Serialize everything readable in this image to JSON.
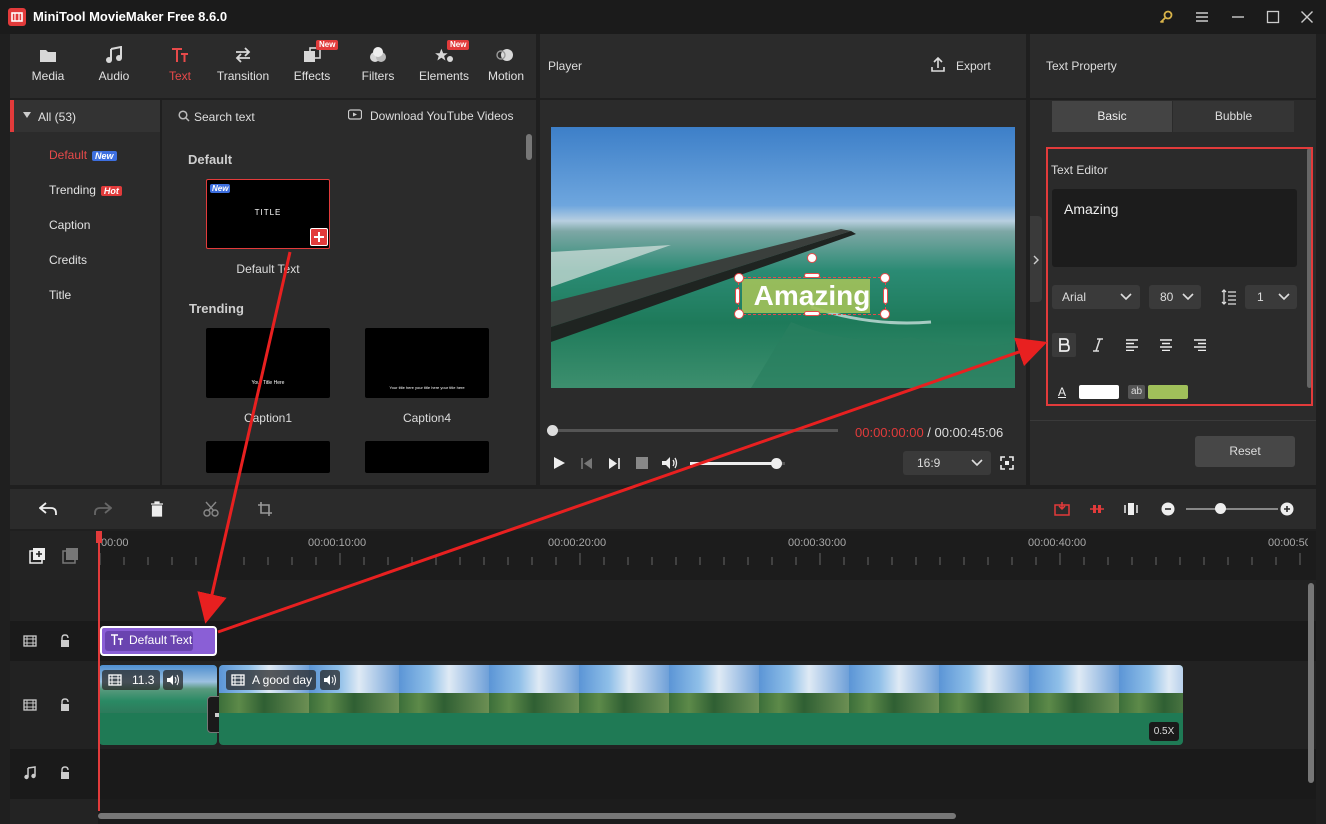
{
  "app": {
    "title": "MiniTool MovieMaker Free 8.6.0"
  },
  "toolbar": {
    "tabs": [
      {
        "label": "Media",
        "icon": "media-icon"
      },
      {
        "label": "Audio",
        "icon": "audio-icon"
      },
      {
        "label": "Text",
        "icon": "text-icon",
        "active": true
      },
      {
        "label": "Transition",
        "icon": "transition-icon"
      },
      {
        "label": "Effects",
        "icon": "effects-icon",
        "badge": "New"
      },
      {
        "label": "Filters",
        "icon": "filters-icon"
      },
      {
        "label": "Elements",
        "icon": "elements-icon",
        "badge": "New"
      },
      {
        "label": "Motion",
        "icon": "motion-icon"
      }
    ]
  },
  "categories": {
    "all_label": "All (53)",
    "items": [
      {
        "label": "Default",
        "badge": "New",
        "active": true
      },
      {
        "label": "Trending",
        "badge": "Hot"
      },
      {
        "label": "Caption"
      },
      {
        "label": "Credits"
      },
      {
        "label": "Title"
      }
    ]
  },
  "library": {
    "search_placeholder": "Search text",
    "download_label": "Download YouTube Videos",
    "sections": [
      {
        "title": "Default",
        "items": [
          {
            "label": "Default Text",
            "thumb_text": "TITLE",
            "badge": "New"
          }
        ]
      },
      {
        "title": "Trending",
        "items": [
          {
            "label": "Caption1",
            "thumb_text": "Your Title Here"
          },
          {
            "label": "Caption4",
            "thumb_text": "Your title here your title here your title here"
          }
        ]
      }
    ]
  },
  "player": {
    "label": "Player",
    "export_label": "Export",
    "overlay_text": "Amazing",
    "current_time": "00:00:00:00",
    "separator": " / ",
    "total_time": "00:00:45:06",
    "aspect": "16:9",
    "volume": 0.9
  },
  "text_property": {
    "title": "Text Property",
    "tabs": [
      "Basic",
      "Bubble"
    ],
    "editor_label": "Text Editor",
    "editor_value": "Amazing",
    "font": "Arial",
    "size": "80",
    "line_spacing": "1",
    "font_color": "#ffffff",
    "bg_color": "#a0c05a",
    "bg_label": "ab",
    "font_color_label": "A",
    "reset_label": "Reset"
  },
  "timeline": {
    "ruler": [
      "00:00",
      "00:00:10:00",
      "00:00:20:00",
      "00:00:30:00",
      "00:00:40:00",
      "00:00:50"
    ],
    "text_clip": "Default Text",
    "clip1_label": "11.3",
    "clip2_label": "A good day",
    "speed_badge": "0.5X"
  },
  "colors": {
    "accent": "#e23b3b",
    "text_clip": "#8a5fd6",
    "video_track": "#1f7a55"
  }
}
